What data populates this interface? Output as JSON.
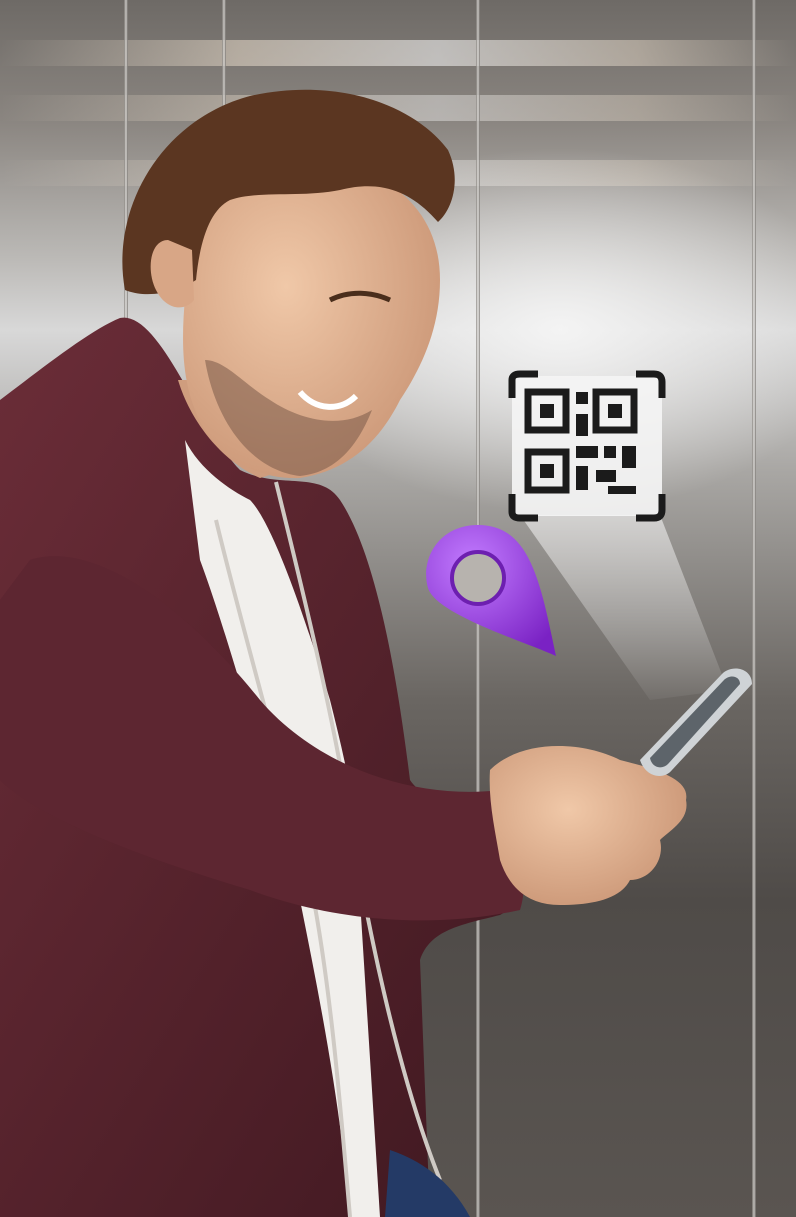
{
  "scene": {
    "subject": "man-in-elevator-using-phone",
    "icons": [
      "qr-code-icon",
      "location-pin-icon",
      "smartphone-icon"
    ],
    "colors": {
      "jacket": "#5a2530",
      "pin": "#9b3de0",
      "qr_frame": "#1b1b1b",
      "steel": "#9a9794"
    }
  }
}
